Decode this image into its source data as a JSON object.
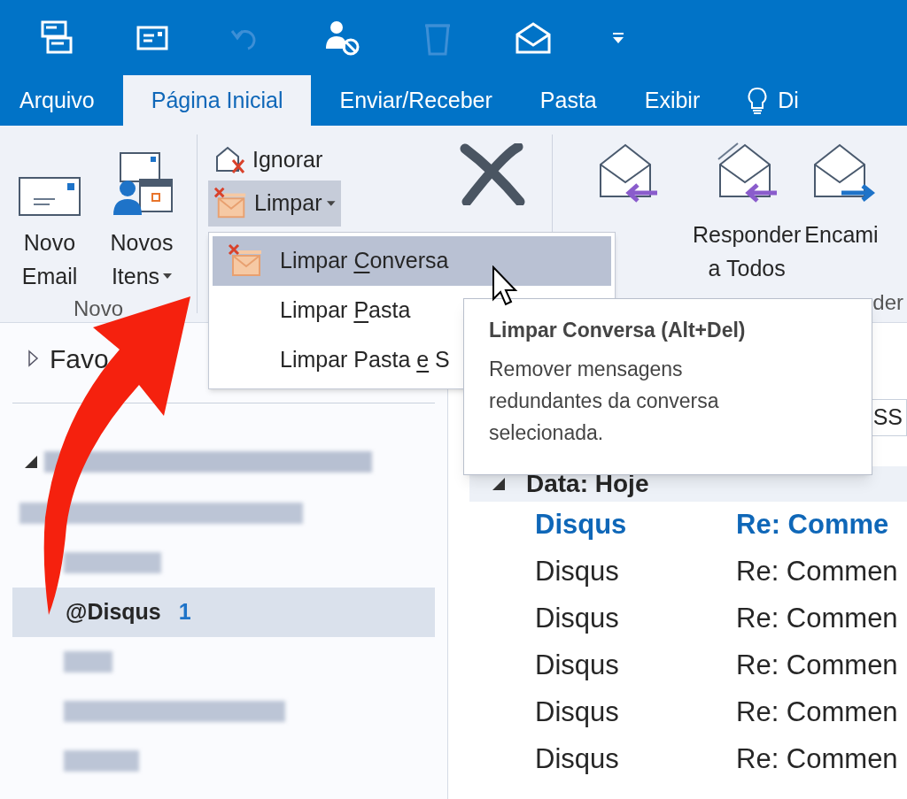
{
  "quick_access": [
    {
      "kind": "send-receive",
      "disabled": false
    },
    {
      "kind": "card",
      "disabled": false
    },
    {
      "kind": "undo",
      "disabled": true
    },
    {
      "kind": "block-user",
      "disabled": false
    },
    {
      "kind": "delete",
      "disabled": true
    },
    {
      "kind": "read",
      "disabled": false
    },
    {
      "kind": "customize",
      "disabled": false
    }
  ],
  "tabs": [
    {
      "label": "Arquivo",
      "kind": "tab",
      "selected": false
    },
    {
      "label": "Página Inicial",
      "kind": "tab",
      "selected": true
    },
    {
      "label": "Enviar/Receber",
      "kind": "tab",
      "selected": false
    },
    {
      "label": "Pasta",
      "kind": "tab",
      "selected": false
    },
    {
      "label": "Exibir",
      "kind": "tab",
      "selected": false
    },
    {
      "label": "Di",
      "kind": "tell-me",
      "selected": false
    }
  ],
  "ribbon": {
    "new_group": {
      "label": "Novo",
      "buttons": [
        {
          "kind": "new-email",
          "lines": [
            "Novo",
            "Email"
          ],
          "dropdown": false
        },
        {
          "kind": "new-items",
          "lines": [
            "Novos",
            "Itens"
          ],
          "dropdown": true
        }
      ]
    },
    "delete_group": {
      "ignore": "Ignorar",
      "clean": {
        "label": "Limpar",
        "pressed": true
      }
    },
    "respond_group": {
      "label": "der",
      "buttons": [
        {
          "kind": "reply"
        },
        {
          "kind": "reply-all",
          "lines": [
            "Responder",
            "a Todos"
          ]
        },
        {
          "kind": "forward",
          "lines": [
            "Encami"
          ]
        }
      ]
    }
  },
  "menu": [
    {
      "before": "Limpar ",
      "key": "C",
      "after": "onversa",
      "has_icon": true,
      "selected": true
    },
    {
      "before": "Limpar ",
      "key": "P",
      "after": "asta",
      "has_icon": false,
      "selected": false
    },
    {
      "before": "Limpar Pasta ",
      "key": "e",
      "after": " S",
      "has_icon": false,
      "selected": false
    }
  ],
  "tooltip": {
    "title": "Limpar Conversa (Alt+Del)",
    "text": "Remover mensagens redundantes da conversa selecionada."
  },
  "navigation": {
    "favorites": {
      "label": "Favo",
      "expanded": false
    },
    "folders": [
      {
        "kind": "account",
        "expanded": true,
        "selected": false
      },
      {
        "kind": "redacted",
        "selected": false
      },
      {
        "kind": "redacted",
        "selected": false
      },
      {
        "kind": "folder",
        "name": "@Disqus",
        "unread": "1",
        "selected": true
      },
      {
        "kind": "redacted",
        "selected": false
      },
      {
        "kind": "redacted",
        "selected": false
      },
      {
        "kind": "redacted",
        "selected": false
      }
    ]
  },
  "search": {
    "value": "SS"
  },
  "messages": {
    "group": {
      "label": "Data: Hoje",
      "expanded": true
    },
    "rows": [
      {
        "sender": "Disqus",
        "subject": "Re: Comme",
        "unread": true
      },
      {
        "sender": "Disqus",
        "subject": "Re: Commen",
        "unread": false
      },
      {
        "sender": "Disqus",
        "subject": "Re: Commen",
        "unread": false
      },
      {
        "sender": "Disqus",
        "subject": "Re: Commen",
        "unread": false
      },
      {
        "sender": "Disqus",
        "subject": "Re: Commen",
        "unread": false
      },
      {
        "sender": "Disqus",
        "subject": "Re: Commen",
        "unread": false
      }
    ]
  }
}
